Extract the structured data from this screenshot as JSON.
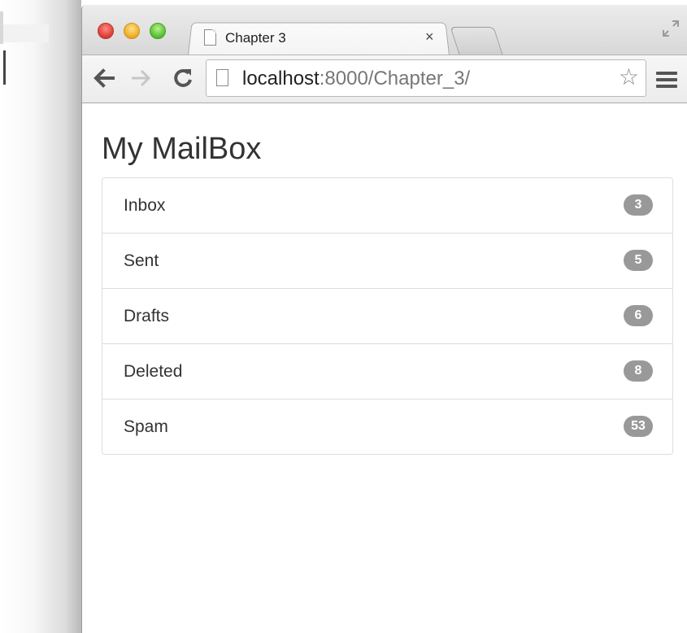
{
  "tab": {
    "title": "Chapter 3",
    "close_glyph": "×"
  },
  "omnibox": {
    "host": "localhost",
    "rest": ":8000/Chapter_3/"
  },
  "page": {
    "title": "My MailBox"
  },
  "mailboxes": [
    {
      "label": "Inbox",
      "count": "3"
    },
    {
      "label": "Sent",
      "count": "5"
    },
    {
      "label": "Drafts",
      "count": "6"
    },
    {
      "label": "Deleted",
      "count": "8"
    },
    {
      "label": "Spam",
      "count": "53"
    }
  ],
  "colors": {
    "badge": "#999999",
    "border": "#dddddd",
    "text": "#333333"
  }
}
